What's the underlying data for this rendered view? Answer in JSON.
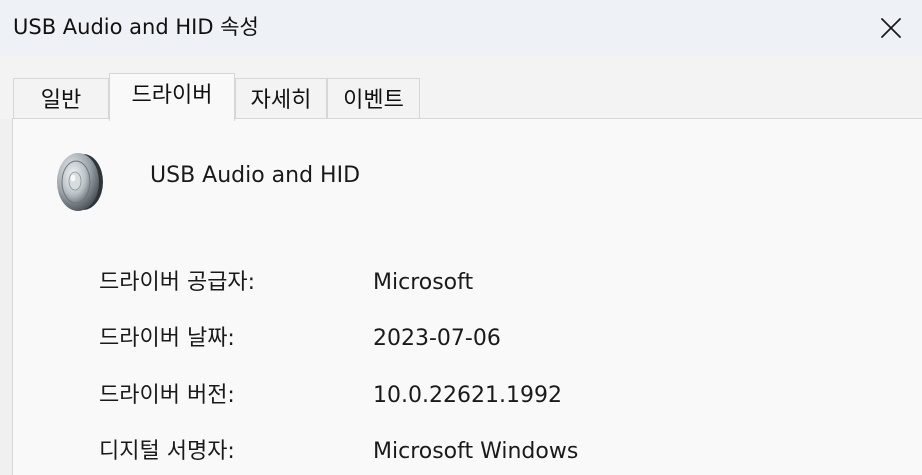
{
  "window": {
    "title": "USB Audio and HID 속성",
    "close_icon": "close-icon"
  },
  "tabs": [
    {
      "label": "일반",
      "active": false
    },
    {
      "label": "드라이버",
      "active": true
    },
    {
      "label": "자세히",
      "active": false
    },
    {
      "label": "이벤트",
      "active": false
    }
  ],
  "device": {
    "icon": "speaker-icon",
    "name": "USB Audio and HID"
  },
  "properties": [
    {
      "label": "드라이버 공급자:",
      "value": "Microsoft"
    },
    {
      "label": "드라이버 날짜:",
      "value": "2023-07-06"
    },
    {
      "label": "드라이버 버전:",
      "value": "10.0.22621.1992"
    },
    {
      "label": "디지털 서명자:",
      "value": "Microsoft Windows"
    }
  ]
}
